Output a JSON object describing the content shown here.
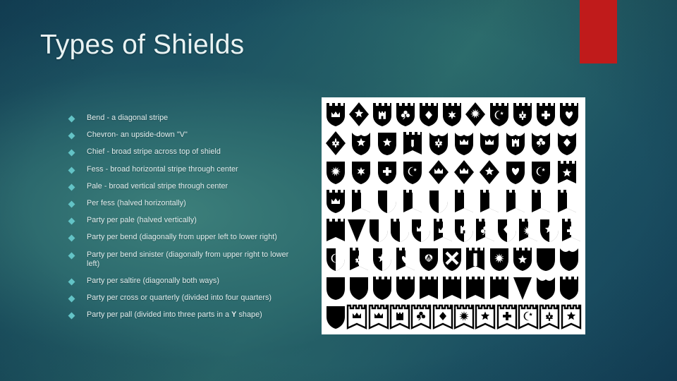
{
  "slide": {
    "title": "Types of Shields",
    "accent_color": "#c01b1b",
    "background_dark": "#15445a",
    "background_light": "#2d6e6d",
    "text_color": "#e3eeee",
    "bullet_marker_color": "#63c3c6"
  },
  "bullets": [
    {
      "text": "Bend - a diagonal stripe"
    },
    {
      "text": "Chevron- an upside-down \"V\""
    },
    {
      "text": "Chief - broad stripe across top of shield"
    },
    {
      "text": "Fess - broad horizontal stripe through center"
    },
    {
      "text": "Pale - broad vertical stripe through center"
    },
    {
      "text": "Per fess (halved horizontally)"
    },
    {
      "text": "Party per pale (halved vertically)"
    },
    {
      "text": "Party per bend (diagonally from upper left to lower right)"
    },
    {
      "text": "Party per bend sinister (diagonally from upper right to lower left)"
    },
    {
      "text": "Party per saltire (diagonally both ways)"
    },
    {
      "text": "Party per cross or quarterly (divided into four quarters)"
    },
    {
      "text": "Party per pall (divided into three parts in a ",
      "bold": "Y",
      "text_after": " shape)"
    }
  ],
  "image_panel": {
    "name": "shield-silhouettes-chart",
    "background": "#ffffff",
    "shape_color": "#000000",
    "rows": 8,
    "columns_per_row": [
      11,
      11,
      11,
      11,
      11,
      11,
      11,
      12
    ],
    "row_shapes": [
      [
        "crown-castle",
        "star-diamond",
        "tower-castle",
        "clover-castle",
        "diamond-castle",
        "sixstar-castle",
        "sunburst-diamond",
        "moon-castle",
        "fleur-castle",
        "cross-castle",
        "heart-castle"
      ],
      [
        "fleur-diamond",
        "star-curved",
        "star-round",
        "ribbon-banner",
        "fleur-curved",
        "crown-curved",
        "crown-curved",
        "tower-curved",
        "clover-curved",
        "diamond-curved"
      ],
      [
        "sunburst-shield",
        "sixstar-shield",
        "cross-shield",
        "moon-shield",
        "crown-diamond",
        "crown-diamond2",
        "star-diamond2",
        "heart-shield",
        "moon-round",
        "star-banner"
      ],
      [
        "crown-castle2",
        "half-shield",
        "half-shield2",
        "half-shield3",
        "half-shield4",
        "half-banner",
        "half-banner2",
        "half-banner3",
        "half-banner4",
        "half-banner5"
      ],
      [
        "vee-banner",
        "vee-shield",
        "half-tower",
        "half-castle",
        "crown-half",
        "crown-half2",
        "tower-half",
        "clover-half",
        "diamond-half",
        "sunburst-half",
        "star-half",
        "cross-half"
      ],
      [
        "moon-half",
        "fleur-half",
        "star-half2",
        "heart-half",
        "shell-shield",
        "saltire-shield",
        "pale-banner",
        "sunburst-round",
        "star-castle",
        "plain-round",
        "plain-curved"
      ],
      [
        "plain-round2",
        "plain-shield",
        "plain-castle",
        "plain-castle2",
        "plain-banner",
        "plain-banner2",
        "plain-banner3",
        "plain-banner4",
        "vee-plain",
        "plain-curved2",
        "plain-castle3"
      ],
      [
        "plain-shield2",
        "crown-outline",
        "crown-outline2",
        "tower-outline",
        "clover-outline",
        "diamond-outline",
        "sunburst-outline",
        "star-outline",
        "cross-outline",
        "moon-outline",
        "fleur-outline",
        "star-outline2"
      ]
    ]
  }
}
